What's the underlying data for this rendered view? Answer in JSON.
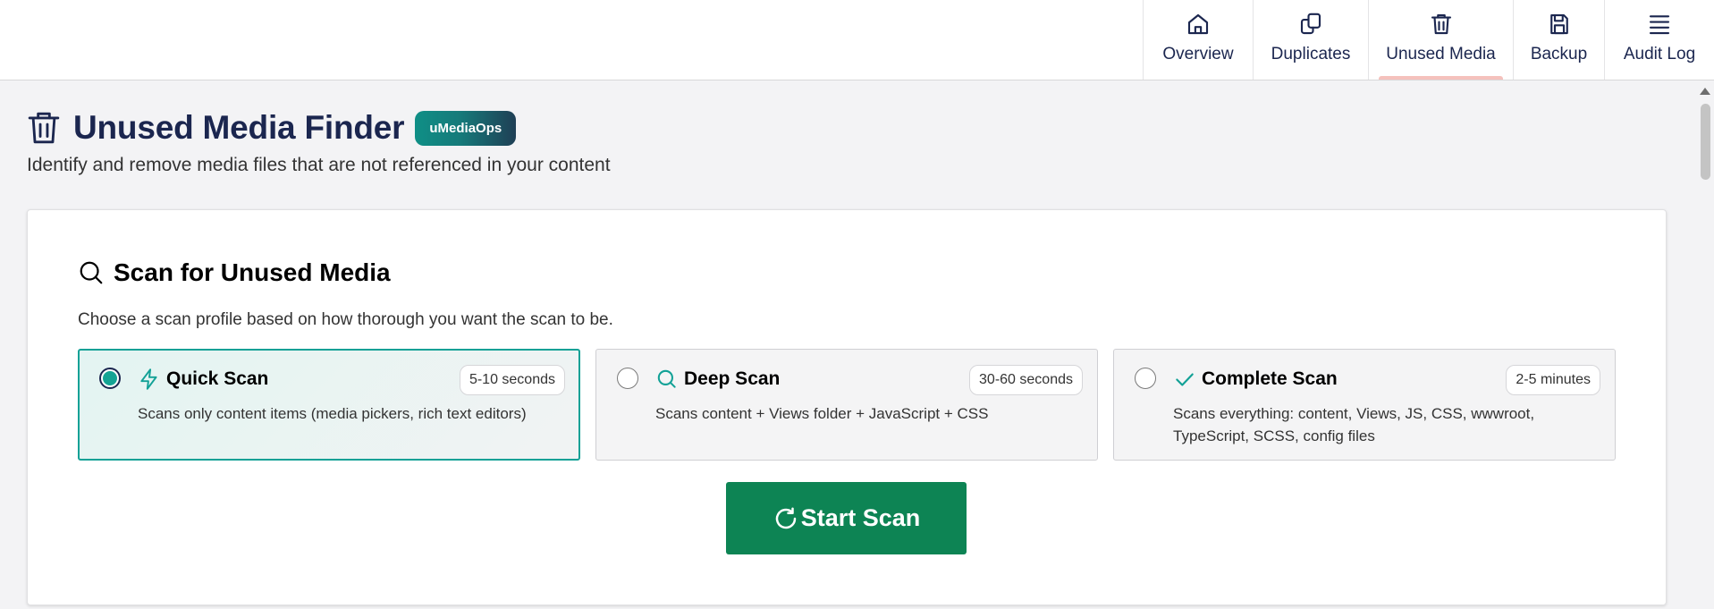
{
  "nav": {
    "tabs": [
      {
        "label": "Overview",
        "icon": "home-icon",
        "active": false
      },
      {
        "label": "Duplicates",
        "icon": "copy-icon",
        "active": false
      },
      {
        "label": "Unused Media",
        "icon": "trash-icon",
        "active": true
      },
      {
        "label": "Backup",
        "icon": "save-icon",
        "active": false
      },
      {
        "label": "Audit Log",
        "icon": "menu-icon",
        "active": false
      }
    ]
  },
  "header": {
    "icon": "trash-icon",
    "title": "Unused Media Finder",
    "badge": "uMediaOps",
    "subtitle": "Identify and remove media files that are not referenced in your content"
  },
  "scan": {
    "icon": "search-icon",
    "title": "Scan for Unused Media",
    "description": "Choose a scan profile based on how thorough you want the scan to be.",
    "selected_profile": "Quick Scan",
    "profiles": [
      {
        "title": "Quick Scan",
        "icon": "lightning-icon",
        "duration": "5-10 seconds",
        "description": "Scans only content items (media pickers, rich text editors)",
        "selected": true
      },
      {
        "title": "Deep Scan",
        "icon": "search-icon",
        "duration": "30-60 seconds",
        "description": "Scans content + Views folder + JavaScript + CSS",
        "selected": false
      },
      {
        "title": "Complete Scan",
        "icon": "check-icon",
        "duration": "2-5 minutes",
        "description": "Scans everything: content, Views, JS, CSS, wwwroot, TypeScript, SCSS, config files",
        "selected": false
      }
    ],
    "start_button": {
      "label": "Start Scan",
      "icon": "refresh-icon"
    }
  },
  "colors": {
    "accent": "#12a196",
    "primary_button": "#0d8454",
    "text_dark": "#1b264f",
    "active_tab_indicator": "#f5c1bc"
  }
}
